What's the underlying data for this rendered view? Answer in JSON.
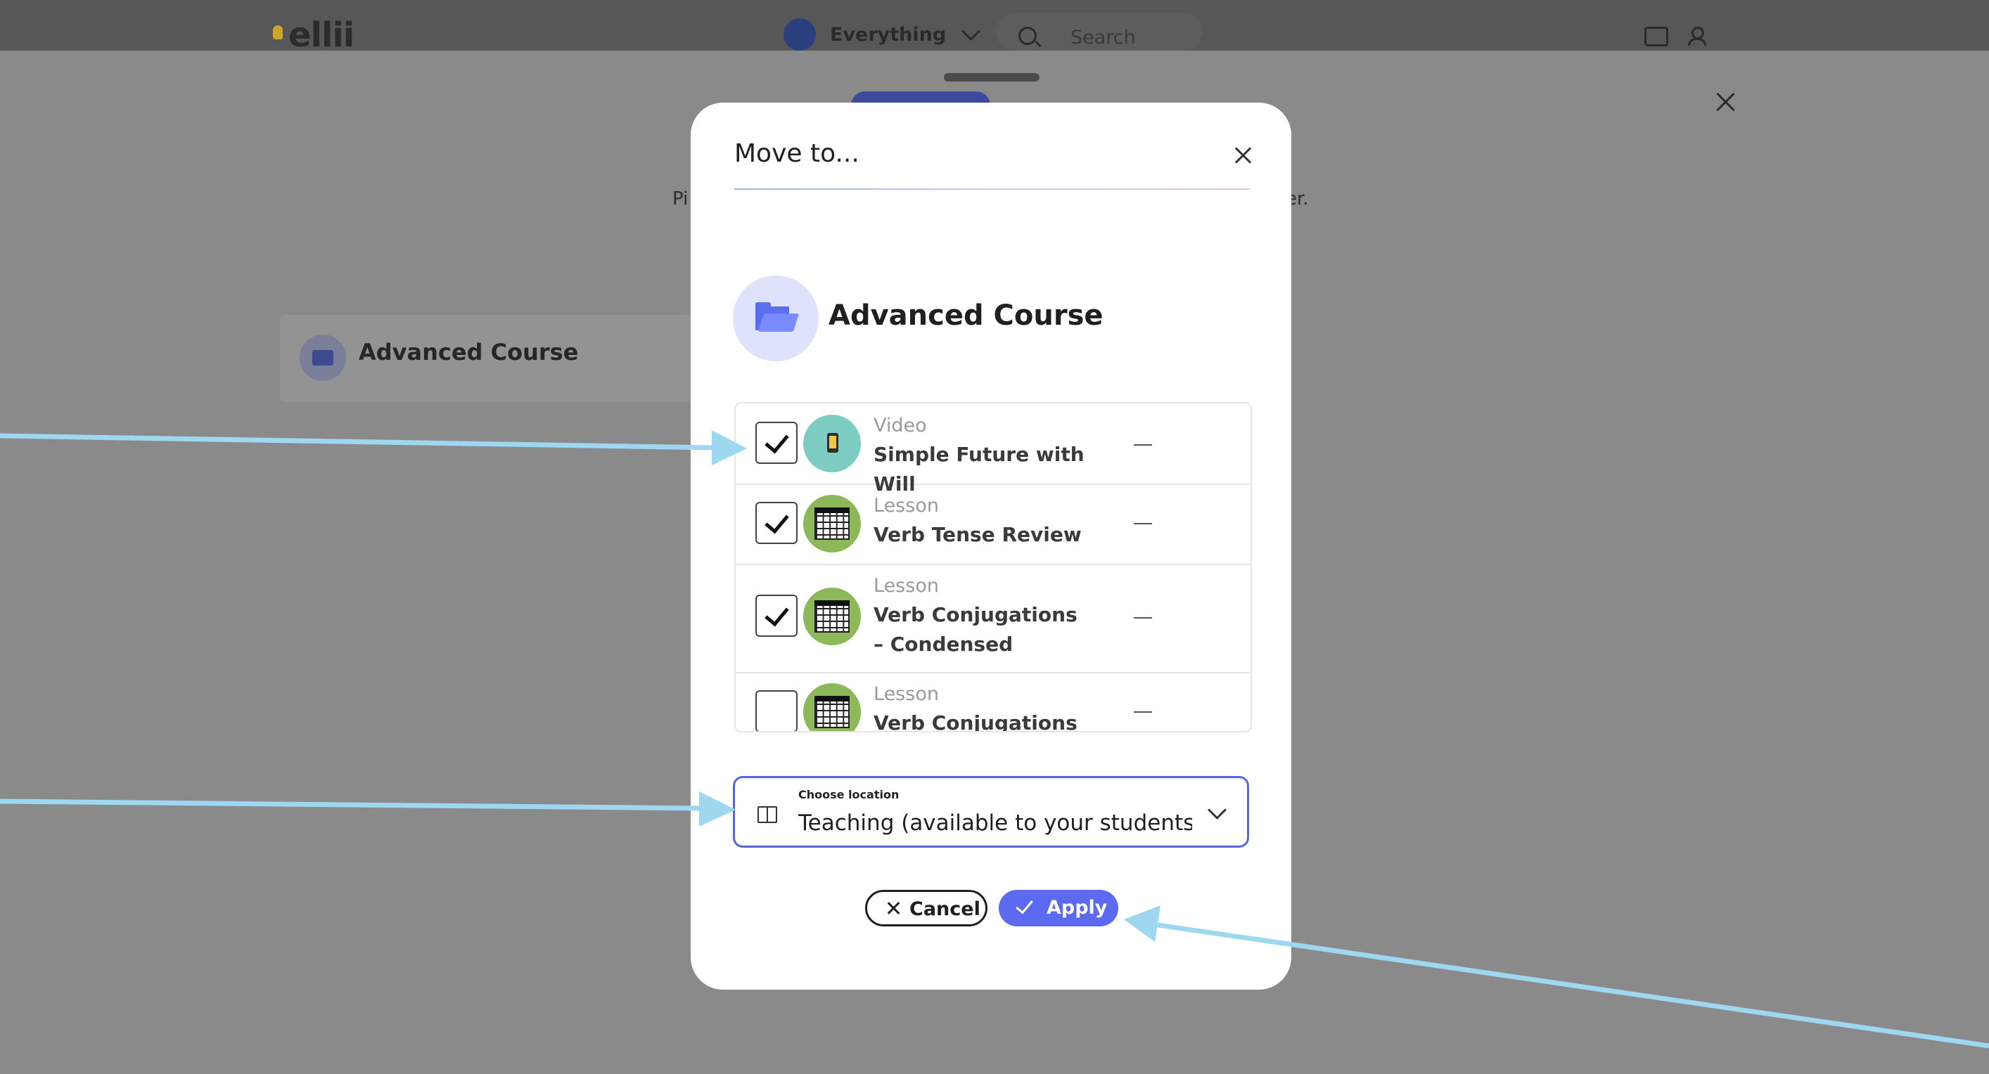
{
  "app": {
    "logo": "ellii",
    "scope_label": "Everything",
    "search_placeholder": "Search",
    "bg_text_left": "Pi",
    "bg_text_right": "er.",
    "bg_card_title": "Advanced Course"
  },
  "modal": {
    "title": "Move to...",
    "course_name": "Advanced Course",
    "items": [
      {
        "type": "Video",
        "name": "Simple Future with Will",
        "checked": true,
        "icon": "video-thumb-icon"
      },
      {
        "type": "Lesson",
        "name": "Verb Tense Review",
        "checked": true,
        "icon": "lesson-grid-icon"
      },
      {
        "type": "Lesson",
        "name": "Verb Conjugations – Condensed",
        "checked": true,
        "icon": "lesson-grid-icon"
      },
      {
        "type": "Lesson",
        "name": "Verb Conjugations",
        "checked": false,
        "icon": "lesson-grid-icon"
      }
    ],
    "dash": "—",
    "location": {
      "caption": "Choose location",
      "value": "Teaching (available to your students immediately)"
    },
    "cancel_label": "Cancel",
    "apply_label": "Apply"
  },
  "colors": {
    "accent": "#5b6af0",
    "overlay": "#8a8a8a",
    "arrow": "#9dd8f0"
  }
}
